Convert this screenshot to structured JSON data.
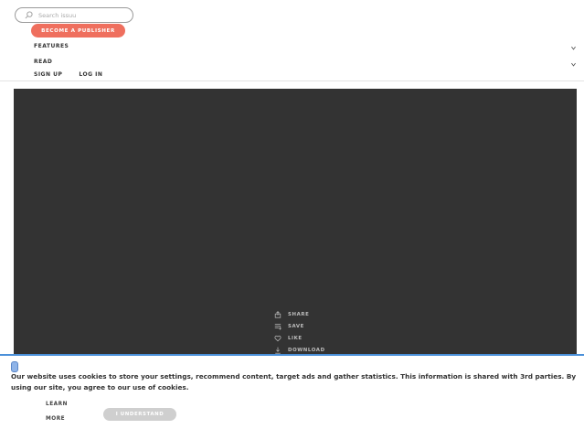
{
  "header": {
    "search": {
      "placeholder": "Search issuu"
    },
    "become_publisher_label": "BECOME A PUBLISHER",
    "nav": [
      {
        "label": "FEATURES",
        "icon": "chevron-down-icon"
      },
      {
        "label": "READ",
        "icon": "chevron-down-icon"
      }
    ],
    "sign_up_label": "SIGN UP",
    "log_in_label": "LOG IN"
  },
  "viewer": {
    "actions": [
      {
        "label": "SHARE",
        "icon": "share-icon"
      },
      {
        "label": "SAVE",
        "icon": "save-icon"
      },
      {
        "label": "LIKE",
        "icon": "heart-icon"
      },
      {
        "label": "DOWNLOAD",
        "icon": "download-icon"
      }
    ]
  },
  "cookie_banner": {
    "text": "Our website uses cookies to store your settings, recommend content, target ads and gather statistics. This information is shared with 3rd parties. By using our site, you agree to our use of cookies.",
    "learn_more_label": "LEARN MORE",
    "understand_label": "I UNDERSTAND"
  },
  "colors": {
    "accent": "#ef6f5e",
    "viewer_bg": "#333333",
    "banner_border": "#4a90d9"
  }
}
